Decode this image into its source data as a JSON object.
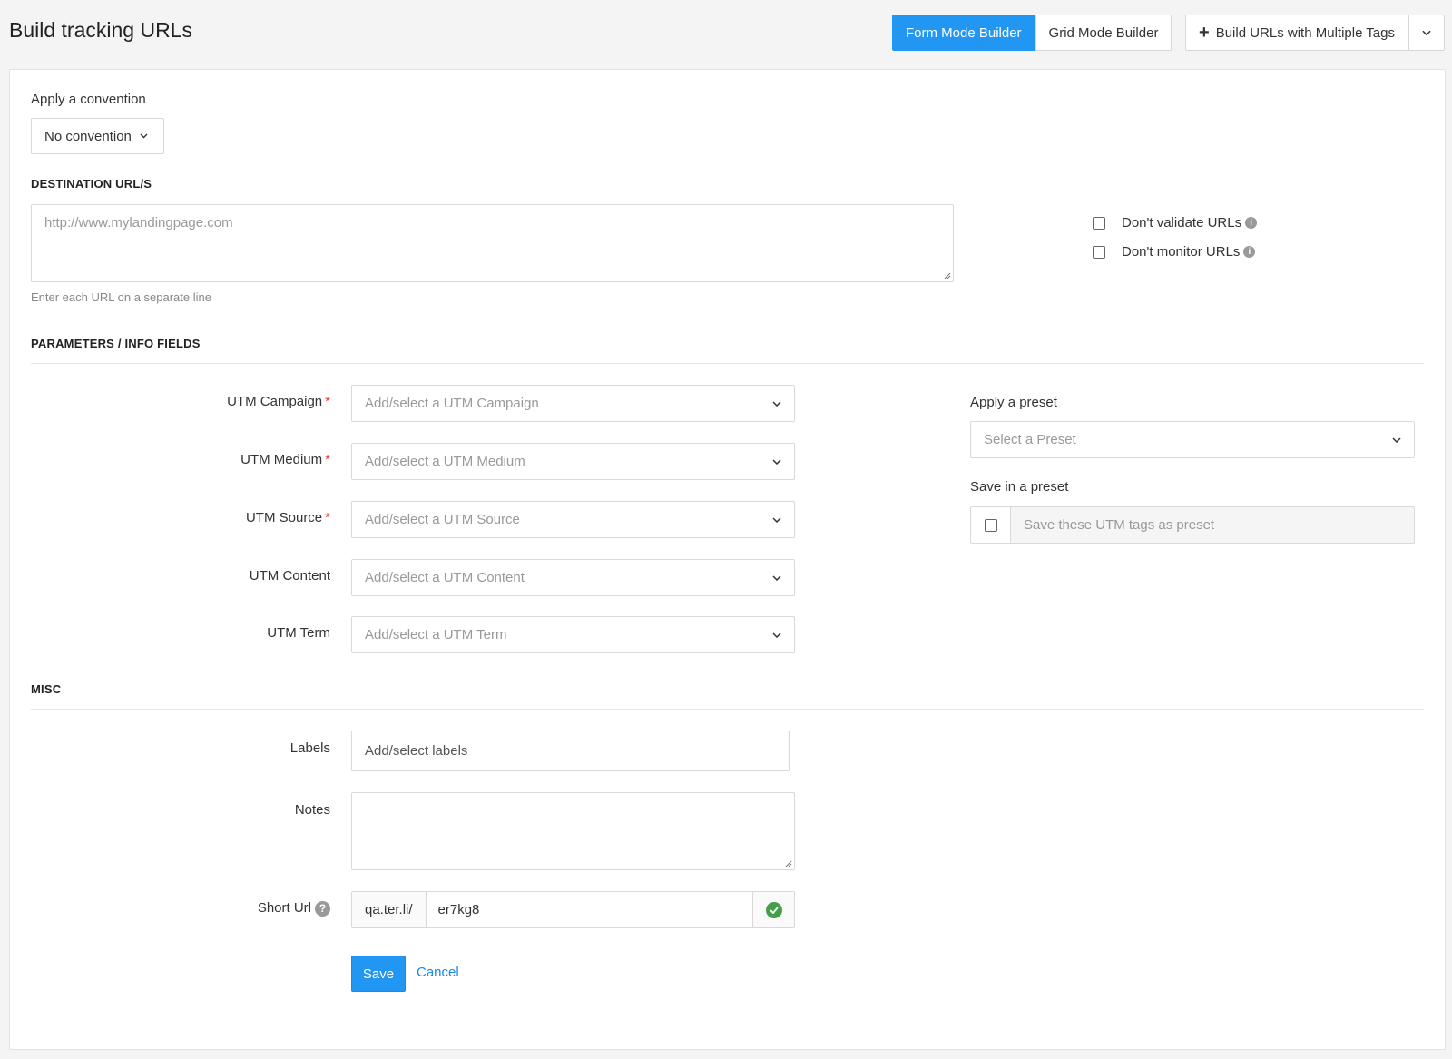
{
  "header": {
    "title": "Build tracking URLs",
    "mode_tabs": [
      {
        "label": "Form Mode Builder",
        "active": true
      },
      {
        "label": "Grid Mode Builder",
        "active": false
      }
    ],
    "multi_tags_label": "Build URLs with Multiple Tags"
  },
  "convention": {
    "label": "Apply a convention",
    "value": "No convention"
  },
  "destination": {
    "title": "DESTINATION URL/S",
    "placeholder": "http://www.mylandingpage.com",
    "help": "Enter each URL on a separate line",
    "dont_validate_label": "Don't validate URLs",
    "dont_monitor_label": "Don't monitor URLs"
  },
  "parameters": {
    "title": "PARAMETERS / INFO FIELDS",
    "fields": [
      {
        "label": "UTM Campaign",
        "required": true,
        "placeholder": "Add/select a UTM Campaign"
      },
      {
        "label": "UTM Medium",
        "required": true,
        "placeholder": "Add/select a UTM Medium"
      },
      {
        "label": "UTM Source",
        "required": true,
        "placeholder": "Add/select a UTM Source"
      },
      {
        "label": "UTM Content",
        "required": false,
        "placeholder": "Add/select a UTM Content"
      },
      {
        "label": "UTM Term",
        "required": false,
        "placeholder": "Add/select a UTM Term"
      }
    ],
    "preset": {
      "apply_label": "Apply a preset",
      "apply_placeholder": "Select a Preset",
      "save_label": "Save in a preset",
      "save_placeholder": "Save these UTM tags as preset"
    }
  },
  "misc": {
    "title": "MISC",
    "labels_label": "Labels",
    "labels_placeholder": "Add/select labels",
    "notes_label": "Notes",
    "short_url_label": "Short Url",
    "short_url_domain": "qa.ter.li/",
    "short_url_slug": "er7kg8"
  },
  "actions": {
    "save": "Save",
    "cancel": "Cancel"
  },
  "colors": {
    "primary": "#2196f3",
    "required": "#e53935",
    "success": "#43a047"
  }
}
